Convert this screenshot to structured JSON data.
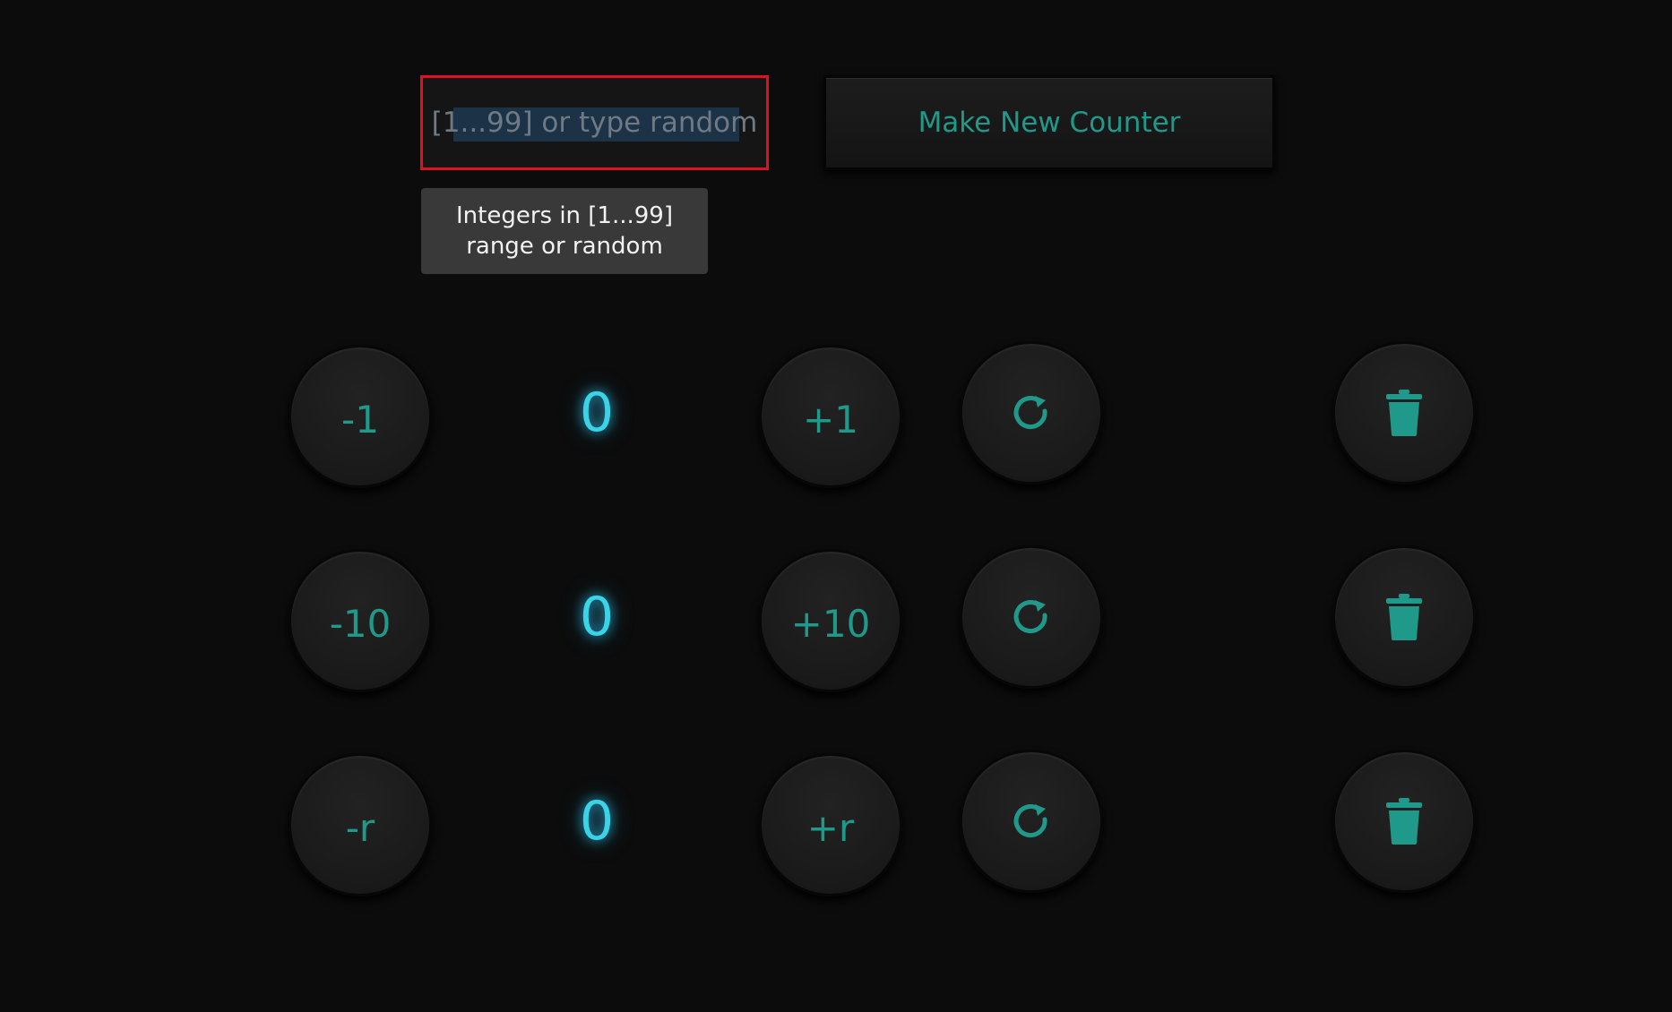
{
  "counter_input": {
    "placeholder": "[1...99] or type random",
    "value": ""
  },
  "make_counter_button": {
    "label": "Make New Counter"
  },
  "tooltip": {
    "text": "Integers in [1...99] range or random"
  },
  "colors": {
    "accent": "#1f9a8a",
    "count_glow": "#39d4e8",
    "focus_border": "#e0101e",
    "background": "#0c0c0c"
  },
  "counters": [
    {
      "decrement_label": "-1",
      "value": "0",
      "increment_label": "+1",
      "reset_icon": "refresh-icon",
      "delete_icon": "trash-icon"
    },
    {
      "decrement_label": "-10",
      "value": "0",
      "increment_label": "+10",
      "reset_icon": "refresh-icon",
      "delete_icon": "trash-icon"
    },
    {
      "decrement_label": "-r",
      "value": "0",
      "increment_label": "+r",
      "reset_icon": "refresh-icon",
      "delete_icon": "trash-icon"
    }
  ]
}
